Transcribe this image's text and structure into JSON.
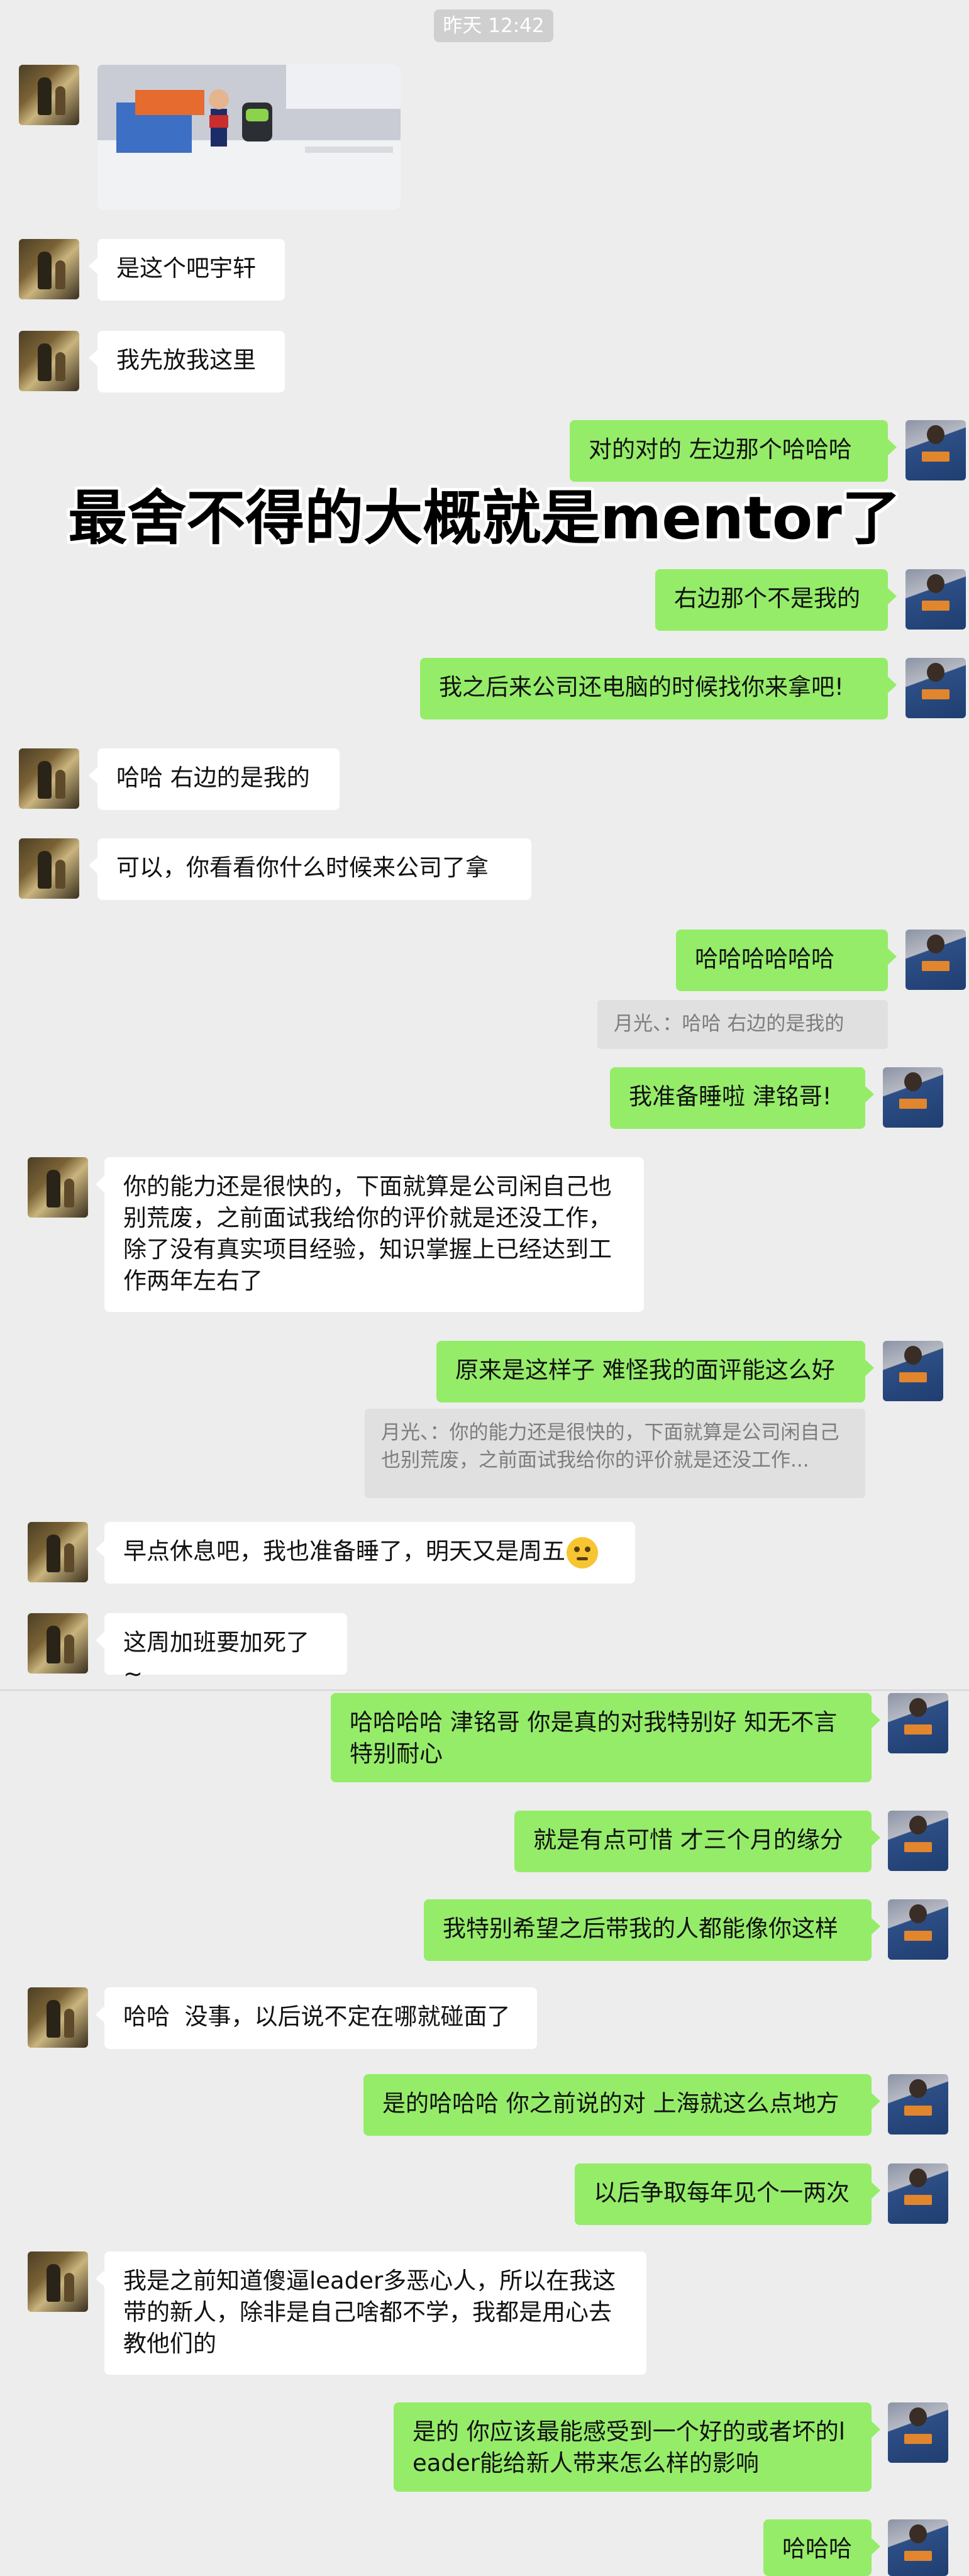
{
  "timestamp": "昨天 12:42",
  "overlay_caption": "最舍不得的大概就是mentor了",
  "messages": {
    "m1": "是这个吧宇轩",
    "m2": "我先放我这里",
    "m3": "对的对的 左边那个哈哈哈",
    "m4": "右边那个不是我的",
    "m5": "我之后来公司还电脑的时候找你来拿吧!",
    "m6": "哈哈 右边的是我的",
    "m7": "可以，你看看你什么时候来公司了拿",
    "m8": "哈哈哈哈哈哈",
    "q1": "月光、：哈哈 右边的是我的",
    "m9": "我准备睡啦 津铭哥!",
    "m10": "你的能力还是很快的，下面就算是公司闲自己也别荒废，之前面试我给你的评价就是还没工作，除了没有真实项目经验，知识掌握上已经达到工作两年左右了",
    "m11": "原来是这样子 难怪我的面评能这么好",
    "q2": "月光、：你的能力还是很快的，下面就算是公司闲自己也别荒废，之前面试我给你的评价就是还没工作...",
    "m12": "早点休息吧，我也准备睡了，明天又是周五",
    "m13": "这周加班要加死了~",
    "m14": "哈哈哈哈 津铭哥 你是真的对我特别好 知无不言 特别耐心",
    "m15": "就是有点可惜 才三个月的缘分",
    "m16": "我特别希望之后带我的人都能像你这样",
    "m17": "哈哈  没事，以后说不定在哪就碰面了",
    "m18": "是的哈哈哈 你之前说的对 上海就这么点地方",
    "m19": "以后争取每年见个一两次",
    "m20": "我是之前知道傻逼leader多恶心人，所以在我这带的新人，除非是自己啥都不学，我都是用心去教他们的",
    "m21": "是的 你应该最能感受到一个好的或者坏的leader能给新人带来怎么样的影响",
    "m22": "哈哈哈"
  },
  "colors": {
    "outgoing_bubble": "#95ec69",
    "incoming_bubble": "#ffffff",
    "background": "#ededed"
  }
}
